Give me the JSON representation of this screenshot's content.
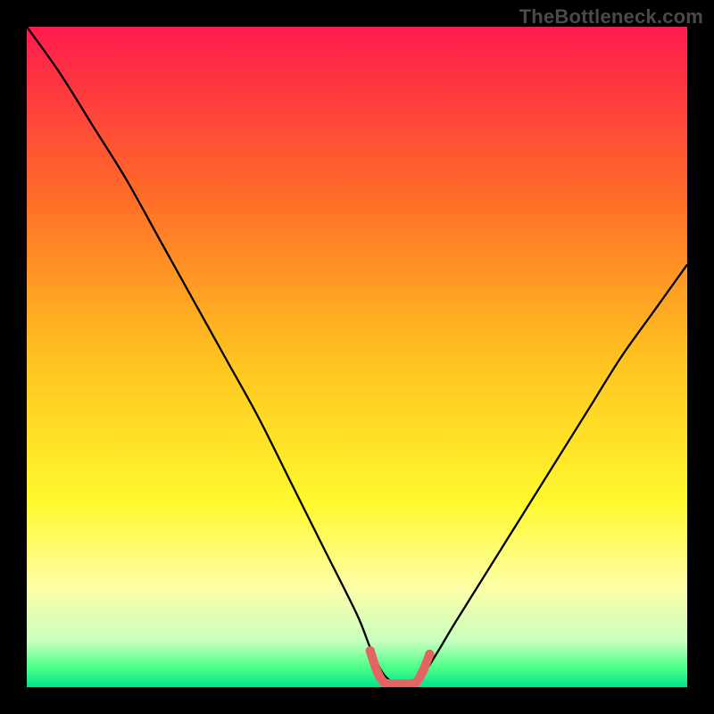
{
  "watermark": "TheBottleneck.com",
  "chart_data": {
    "type": "line",
    "title": "",
    "xlabel": "",
    "ylabel": "",
    "xlim": [
      0,
      100
    ],
    "ylim": [
      0,
      100
    ],
    "series": [
      {
        "name": "curve",
        "x": [
          0,
          5,
          10,
          15,
          20,
          25,
          30,
          35,
          40,
          45,
          50,
          52,
          54,
          56,
          58,
          60,
          62,
          65,
          70,
          75,
          80,
          85,
          90,
          95,
          100
        ],
        "y": [
          100,
          93,
          85,
          77,
          68,
          59,
          50,
          41,
          31,
          21,
          11,
          6,
          2,
          0.5,
          0.5,
          2,
          5,
          10,
          18,
          26,
          34,
          42,
          50,
          57,
          64
        ]
      }
    ],
    "valley_marker": {
      "points": [
        {
          "x": 52,
          "y": 5.5
        },
        {
          "x": 53,
          "y": 2.5
        },
        {
          "x": 54,
          "y": 0.8
        },
        {
          "x": 55,
          "y": 0.5
        },
        {
          "x": 56,
          "y": 0.5
        },
        {
          "x": 57,
          "y": 0.5
        },
        {
          "x": 58,
          "y": 0.5
        },
        {
          "x": 59,
          "y": 0.8
        },
        {
          "x": 60,
          "y": 2.5
        },
        {
          "x": 61,
          "y": 5.0
        }
      ],
      "color": "#e46464"
    },
    "background": {
      "type": "gradient",
      "stops": [
        {
          "offset": 0.0,
          "color": "#ff1a4d"
        },
        {
          "offset": 0.25,
          "color": "#ff6a29"
        },
        {
          "offset": 0.5,
          "color": "#ffc21f"
        },
        {
          "offset": 0.72,
          "color": "#fff92e"
        },
        {
          "offset": 0.85,
          "color": "#fdffa8"
        },
        {
          "offset": 0.93,
          "color": "#c8ffbe"
        },
        {
          "offset": 0.97,
          "color": "#4cff8a"
        },
        {
          "offset": 1.0,
          "color": "#00e58a"
        }
      ]
    }
  }
}
